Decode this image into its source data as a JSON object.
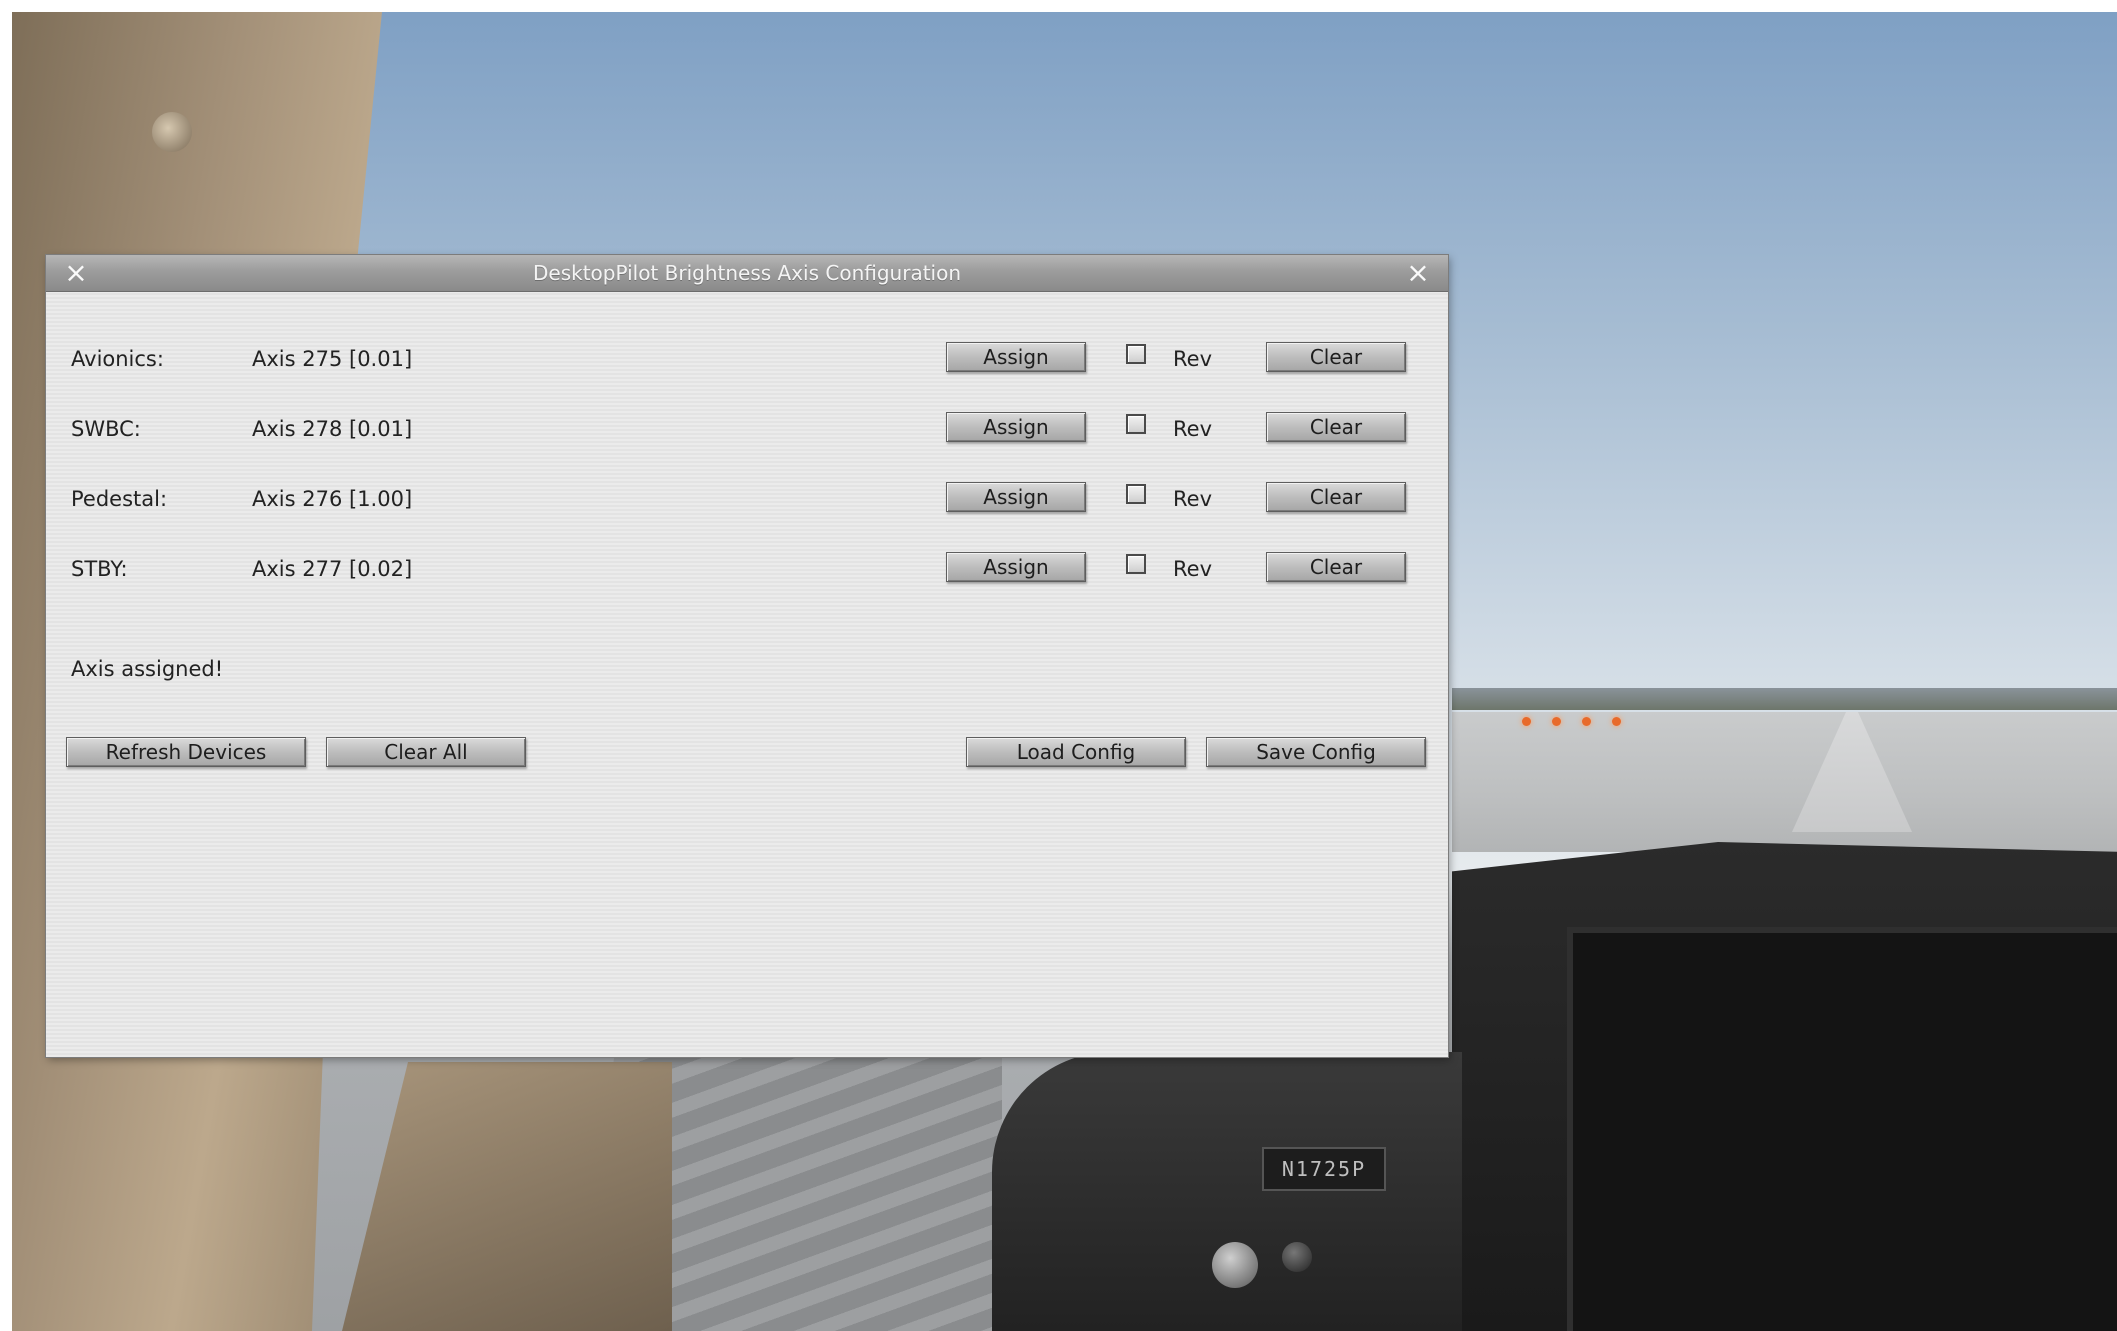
{
  "dialog": {
    "title": "DesktopPilot Brightness Axis Configuration",
    "close_icon": "×",
    "rows": [
      {
        "label": "Avionics:",
        "value": "Axis 275 [0.01]",
        "assign": "Assign",
        "rev": "Rev",
        "rev_checked": false,
        "clear": "Clear"
      },
      {
        "label": "SWBC:",
        "value": "Axis 278 [0.01]",
        "assign": "Assign",
        "rev": "Rev",
        "rev_checked": false,
        "clear": "Clear"
      },
      {
        "label": "Pedestal:",
        "value": "Axis 276 [1.00]",
        "assign": "Assign",
        "rev": "Rev",
        "rev_checked": false,
        "clear": "Clear"
      },
      {
        "label": "STBY:",
        "value": "Axis 277 [0.02]",
        "assign": "Assign",
        "rev": "Rev",
        "rev_checked": false,
        "clear": "Clear"
      }
    ],
    "status": "Axis assigned!",
    "buttons": {
      "refresh": "Refresh Devices",
      "clear_all": "Clear All",
      "load": "Load Config",
      "save": "Save Config"
    }
  },
  "background": {
    "tail_number": "N1725P"
  },
  "colors": {
    "titlebar": "#9c9c9c",
    "dialog_bg": "#e6e6e6",
    "button_face": "#bdbdbd"
  }
}
